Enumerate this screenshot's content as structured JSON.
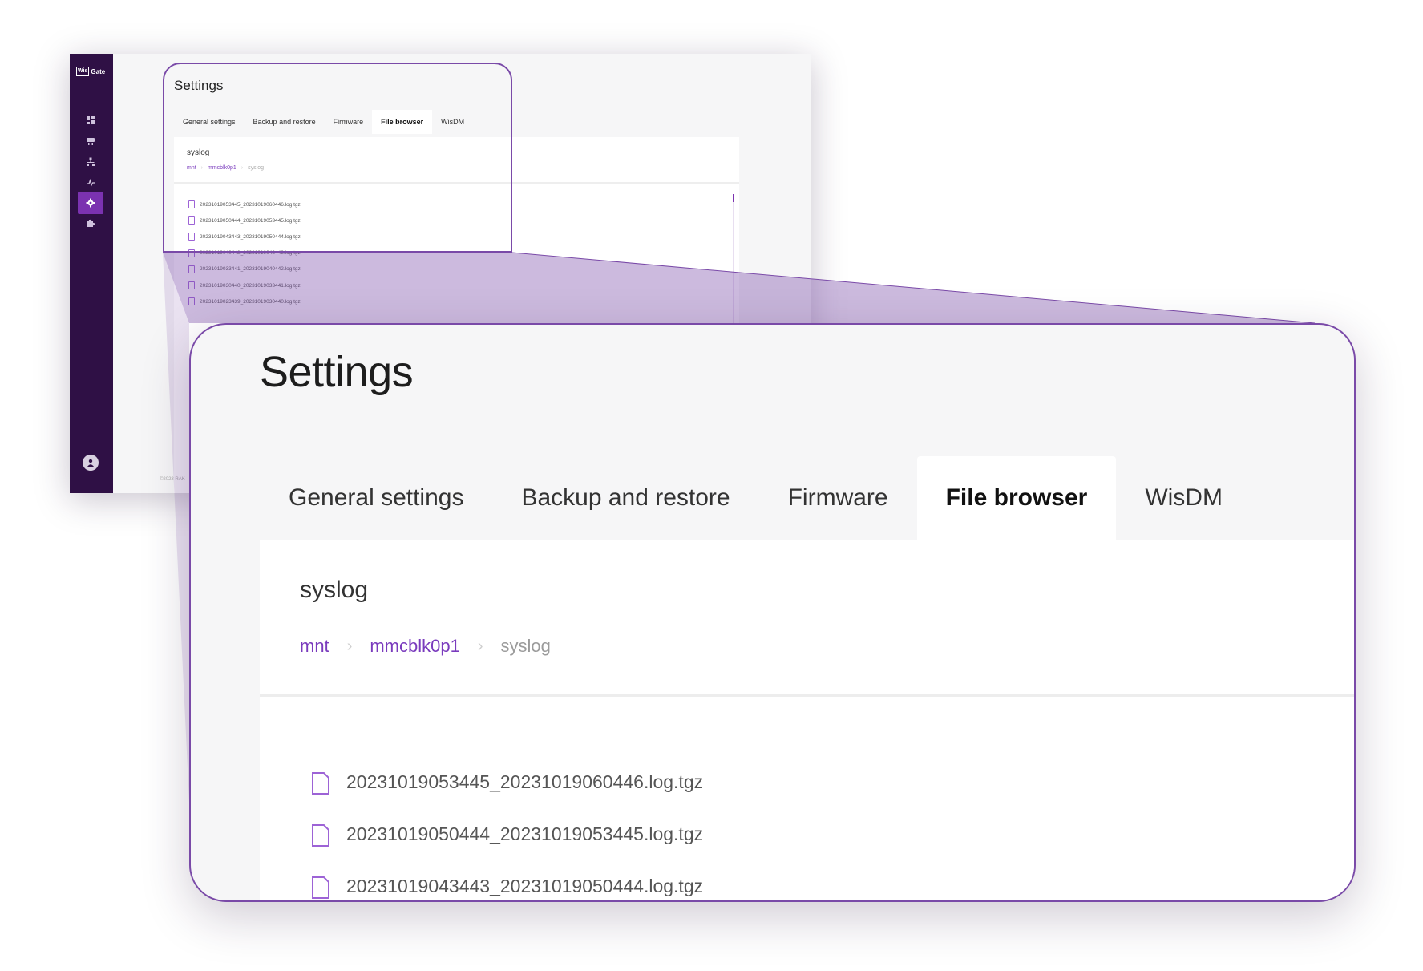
{
  "brand": {
    "logo_box": "Wis",
    "logo_text": "Gate"
  },
  "sidebar": {
    "items": [
      {
        "icon": "dashboard-icon",
        "active": false
      },
      {
        "icon": "network-icon",
        "active": false
      },
      {
        "icon": "topology-icon",
        "active": false
      },
      {
        "icon": "activity-icon",
        "active": false
      },
      {
        "icon": "gear-icon",
        "active": true
      },
      {
        "icon": "puzzle-icon",
        "active": false
      }
    ],
    "user_icon": "user-icon"
  },
  "footer": {
    "copyright": "©2023 RAK"
  },
  "page": {
    "title": "Settings"
  },
  "tabs": [
    {
      "label": "General settings",
      "active": false
    },
    {
      "label": "Backup and restore",
      "active": false
    },
    {
      "label": "Firmware",
      "active": false
    },
    {
      "label": "File browser",
      "active": true
    },
    {
      "label": "WisDM",
      "active": false
    }
  ],
  "browser": {
    "folder": "syslog",
    "breadcrumb": [
      "mnt",
      "mmcblk0p1",
      "syslog"
    ],
    "files": [
      "20231019053445_20231019060446.log.tgz",
      "20231019050444_20231019053445.log.tgz",
      "20231019043443_20231019050444.log.tgz",
      "20231019040442_20231019043443.log.tgz",
      "20231019033441_20231019040442.log.tgz",
      "20231019030440_20231019033441.log.tgz",
      "20231019023439_20231019030440.log.tgz"
    ]
  },
  "colors": {
    "accent": "#7a3bbd",
    "sidebar": "#2f1045",
    "highlight": "#7a4aa8"
  }
}
